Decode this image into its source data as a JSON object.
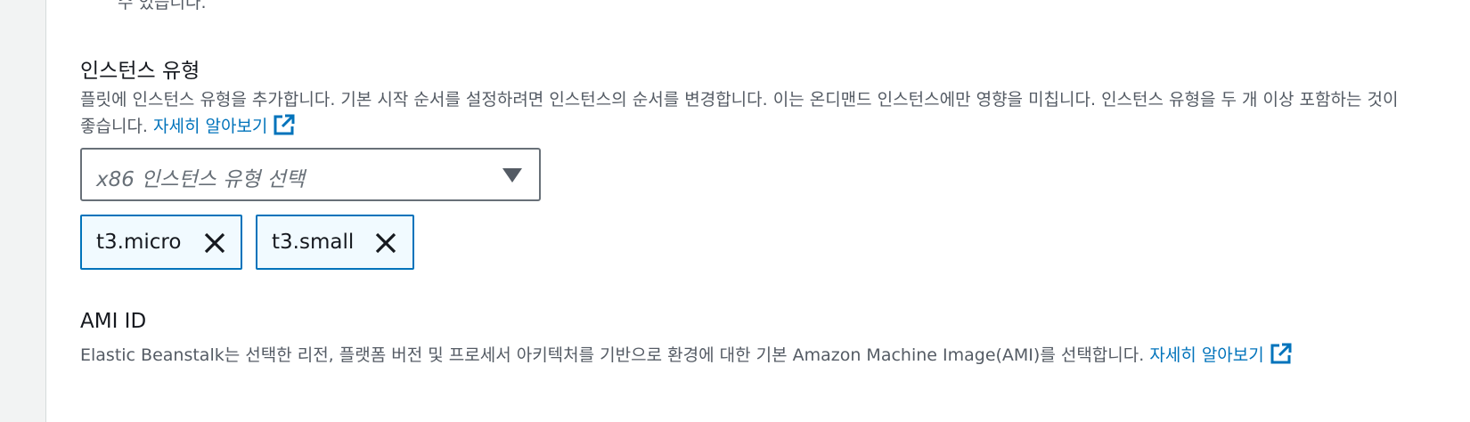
{
  "top_cut_text": "수 있습니다.",
  "instance_types": {
    "title": "인스턴스 유형",
    "description": "플릿에 인스턴스 유형을 추가합니다. 기본 시작 순서를 설정하려면 인스턴스의 순서를 변경합니다. 이는 온디맨드 인스턴스에만 영향을 미칩니다. 인스턴스 유형을 두 개 이상 포함하는 것이 좋습니다.",
    "learn_more": "자세히 알아보기",
    "select_placeholder": "x86 인스턴스 유형 선택",
    "tokens": [
      {
        "label": "t3.micro"
      },
      {
        "label": "t3.small"
      }
    ]
  },
  "ami": {
    "title": "AMI ID",
    "description": "Elastic Beanstalk는 선택한 리전, 플랫폼 버전 및 프로세서 아키텍처를 기반으로 환경에 대한 기본 Amazon Machine Image(AMI)를 선택합니다.",
    "learn_more": "자세히 알아보기"
  },
  "colors": {
    "link": "#0073bb",
    "token_border": "#0073bb",
    "token_bg": "#f1faff"
  }
}
